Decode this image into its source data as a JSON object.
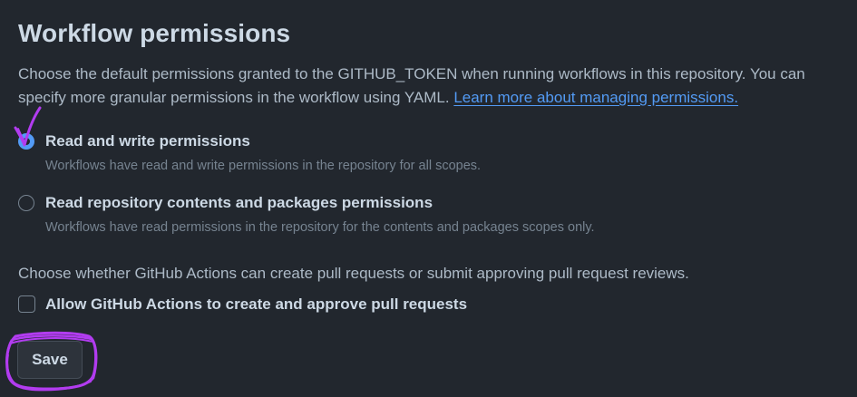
{
  "section": {
    "title": "Workflow permissions",
    "description_text": "Choose the default permissions granted to the GITHUB_TOKEN when running workflows in this repository. You can specify more granular permissions in the workflow using YAML.",
    "learn_more_link": "Learn more about managing permissions."
  },
  "permission_options": [
    {
      "label": "Read and write permissions",
      "note": "Workflows have read and write permissions in the repository for all scopes.",
      "selected": true
    },
    {
      "label": "Read repository contents and packages permissions",
      "note": "Workflows have read permissions in the repository for the contents and packages scopes only.",
      "selected": false
    }
  ],
  "pull_requests": {
    "question": "Choose whether GitHub Actions can create pull requests or submit approving pull request reviews.",
    "checkbox_label": "Allow GitHub Actions to create and approve pull requests",
    "checked": false
  },
  "save_button": {
    "label": "Save"
  },
  "colors": {
    "background": "#22272e",
    "heading": "#cdd9e5",
    "body_text": "#adbac7",
    "muted_text": "#768390",
    "link": "#539bf5",
    "annotation": "#b23cf0"
  },
  "annotations": {
    "checkmark_icon": "checkmark-icon",
    "circle_highlight": "save-highlight-scribble"
  }
}
